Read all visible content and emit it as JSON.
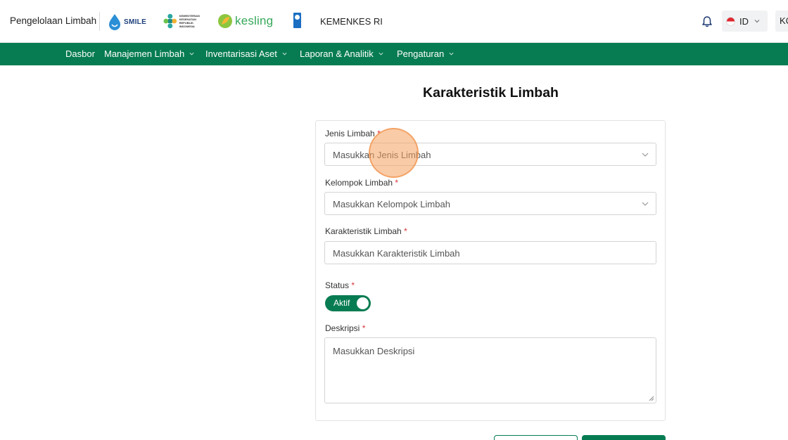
{
  "header": {
    "app_title": "Pengelolaan Limbah",
    "smile_logo_text": "SMILE",
    "kemkes_logo_text": "KEMENTERIAN KESEHATAN REPUBLIK INDONESIA",
    "kesling_logo_text": "kesling",
    "org_name": "KEMENKES RI",
    "language_code": "ID",
    "user_initials": "KC"
  },
  "nav": {
    "items": [
      {
        "label": "Dasbor",
        "has_dropdown": false
      },
      {
        "label": "Manajemen Limbah",
        "has_dropdown": true
      },
      {
        "label": "Inventarisasi Aset",
        "has_dropdown": true
      },
      {
        "label": "Laporan & Analitik",
        "has_dropdown": true
      },
      {
        "label": "Pengaturan",
        "has_dropdown": true
      }
    ]
  },
  "form": {
    "title": "Karakteristik Limbah",
    "required_mark": "*",
    "jenis_limbah": {
      "label": "Jenis Limbah",
      "placeholder": "Masukkan Jenis Limbah"
    },
    "kelompok_limbah": {
      "label": "Kelompok Limbah",
      "placeholder": "Masukkan Kelompok Limbah"
    },
    "karakteristik_limbah": {
      "label": "Karakteristik Limbah",
      "placeholder": "Masukkan Karakteristik Limbah"
    },
    "status": {
      "label": "Status",
      "toggle_text": "Aktif",
      "enabled": true
    },
    "deskripsi": {
      "label": "Deskripsi",
      "placeholder": "Masukkan Deskripsi"
    }
  },
  "colors": {
    "brand_green": "#077c52",
    "required_red": "#d9363e",
    "click_marker": "#f5a05f"
  },
  "icons": {
    "notification": "bell-icon",
    "dropdown": "chevron-down-icon",
    "language_flag": "indonesia-flag-icon"
  }
}
